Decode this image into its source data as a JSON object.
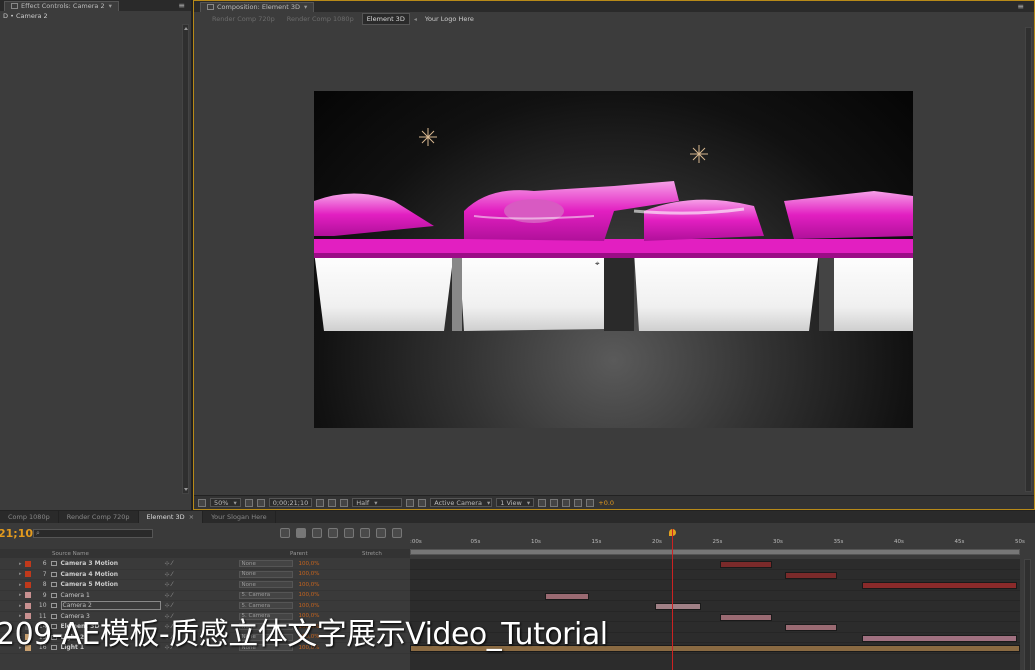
{
  "left_panel": {
    "tab_label": "Effect Controls: Camera 2",
    "sub_label": "D • Camera 2"
  },
  "comp_panel": {
    "tab_label": "Composition: Element 3D",
    "subtabs": [
      "Render Comp 720p",
      "Render Comp 1080p",
      "Element 3D",
      "Your Logo Here"
    ],
    "bottombar": {
      "zoom": "50%",
      "timecode": "0;00;21;10",
      "resolution": "Half",
      "view": "Active Camera",
      "views": "1 View",
      "exposure": "+0.0"
    }
  },
  "timeline": {
    "tabs": [
      "Comp 1080p",
      "Render Comp 720p",
      "Element 3D",
      "Your Slogan Here"
    ],
    "timecode": "21;10",
    "search_placeholder": "⌕",
    "headers": {
      "source_name": "Source Name",
      "parent": "Parent",
      "stretch": "Stretch"
    },
    "ruler_labels": [
      ":00s",
      "05s",
      "10s",
      "15s",
      "20s",
      "25s",
      "30s",
      "35s",
      "40s",
      "45s",
      "50s"
    ],
    "layers": [
      {
        "num": "6",
        "name": "Camera 3 Motion",
        "color": "#c0391b",
        "parent": "None",
        "stretch": "100,0%"
      },
      {
        "num": "7",
        "name": "Camera 4 Motion",
        "color": "#c0391b",
        "parent": "None",
        "stretch": "100,0%"
      },
      {
        "num": "8",
        "name": "Camera 5 Motion",
        "color": "#c0391b",
        "parent": "None",
        "stretch": "100,0%"
      },
      {
        "num": "9",
        "name": "Camera 1",
        "color": "#c89090",
        "parent": "5. Camera",
        "stretch": "100,0%"
      },
      {
        "num": "10",
        "name": "Camera 2",
        "color": "#c89090",
        "parent": "5. Camera",
        "stretch": "100,0%"
      },
      {
        "num": "11",
        "name": "Camera 3",
        "color": "#c89090",
        "parent": "5. Camera",
        "stretch": "100,0%"
      },
      {
        "num": "14",
        "name": "Element 3D",
        "color": "#555555",
        "parent": "None",
        "stretch": "100,0%"
      },
      {
        "num": "15",
        "name": "Light 2",
        "color": "#c8a070",
        "parent": "None",
        "stretch": "100,0%"
      },
      {
        "num": "16",
        "name": "Light 1",
        "color": "#c8a070",
        "parent": "None",
        "stretch": "100,0%"
      }
    ]
  },
  "watermark": "209-AE模板-质感立体文字展示Video_Tutorial",
  "colors": {
    "accent": "#e39a1e",
    "panel_bg": "#3c3c3c",
    "magenta": "#e21fc1"
  }
}
